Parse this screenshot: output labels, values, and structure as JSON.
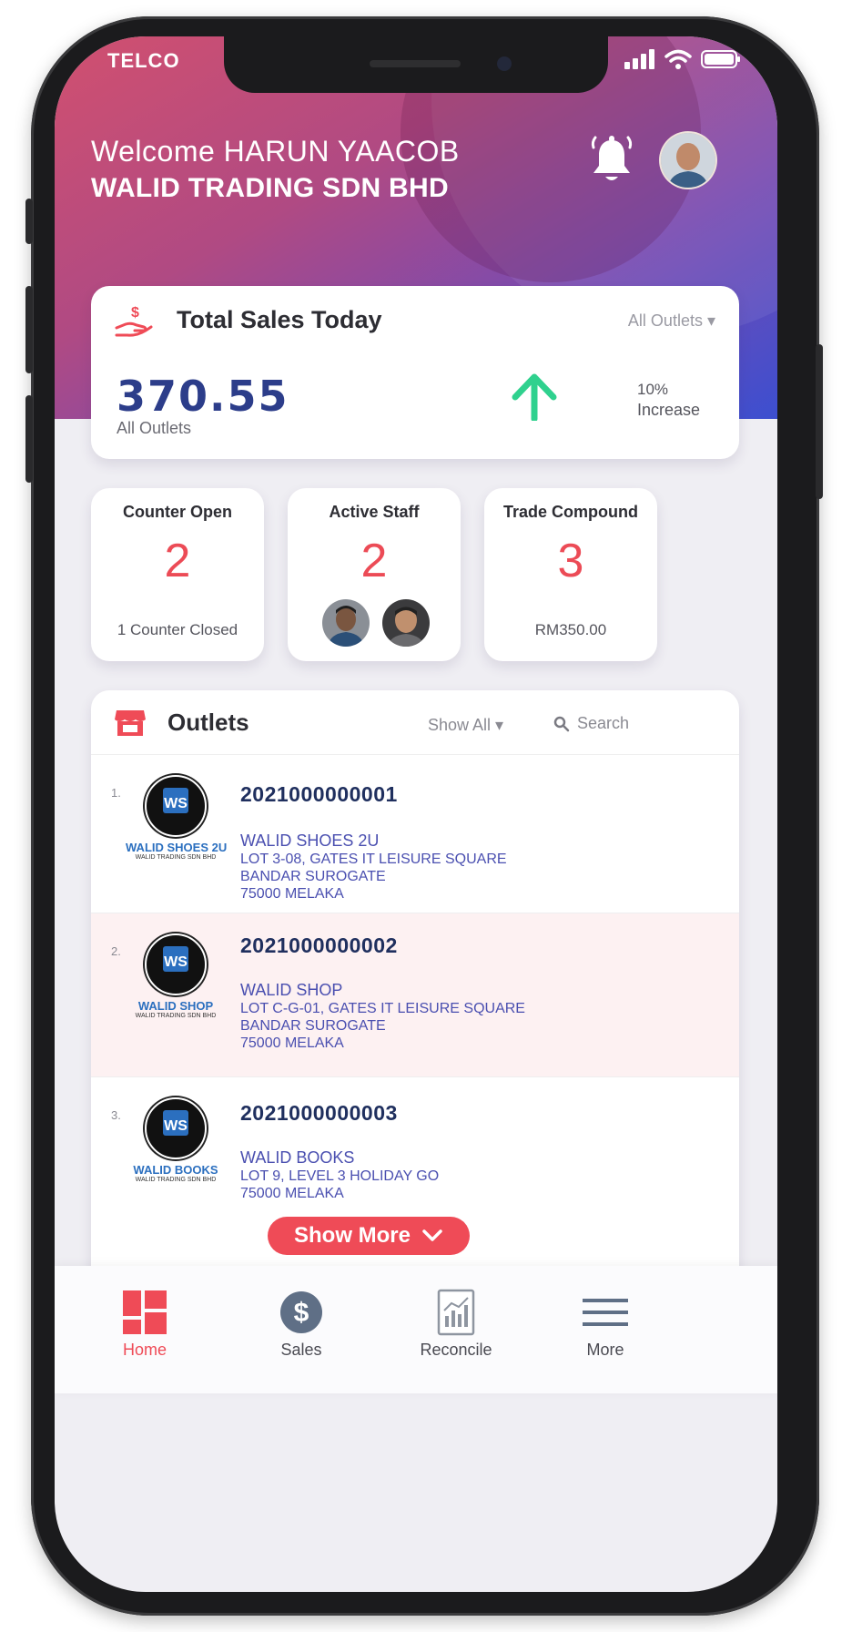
{
  "status_bar": {
    "carrier": "TELCO"
  },
  "header": {
    "welcome": "Welcome HARUN YAACOB",
    "company": "WALID TRADING SDN BHD"
  },
  "sales": {
    "title": "Total Sales Today",
    "filter": "All Outlets ▾",
    "amount": "370.55",
    "subtitle": "All Outlets",
    "change_pct": "10%",
    "change_label": "Increase"
  },
  "stats": [
    {
      "label": "Counter Open",
      "value": "2",
      "footer": "1 Counter Closed"
    },
    {
      "label": "Active Staff",
      "value": "2"
    },
    {
      "label": "Trade Compound",
      "value": "3",
      "footer": "RM350.00"
    }
  ],
  "outlets": {
    "title": "Outlets",
    "show_all": "Show All ▾",
    "search_placeholder": "Search",
    "items": [
      {
        "num": "1.",
        "logo_name": "WALID SHOES 2U",
        "logo_sub": "WALID TRADING SDN BHD",
        "id": "2021000000001",
        "name": "WALID SHOES 2U",
        "lines": [
          "LOT 3-08, GATES IT LEISURE SQUARE",
          "BANDAR SUROGATE",
          "75000 MELAKA"
        ]
      },
      {
        "num": "2.",
        "logo_name": "WALID SHOP",
        "logo_sub": "WALID TRADING SDN BHD",
        "id": "2021000000002",
        "name": "WALID SHOP",
        "lines": [
          "LOT C-G-01, GATES IT LEISURE SQUARE",
          "BANDAR SUROGATE",
          "75000 MELAKA"
        ]
      },
      {
        "num": "3.",
        "logo_name": "WALID BOOKS",
        "logo_sub": "WALID TRADING SDN BHD",
        "id": "2021000000003",
        "name": "WALID BOOKS",
        "lines": [
          "LOT 9, LEVEL 3 HOLIDAY GO",
          "75000 MELAKA"
        ]
      }
    ],
    "show_more": "Show More"
  },
  "tabbar": {
    "home": "Home",
    "sales": "Sales",
    "reconcile": "Reconcile",
    "more": "More"
  },
  "colors": {
    "accent": "#ef4b57",
    "navy": "#2c3d8a",
    "increase": "#2fd18e",
    "selected_row": "#fdf1f2"
  }
}
